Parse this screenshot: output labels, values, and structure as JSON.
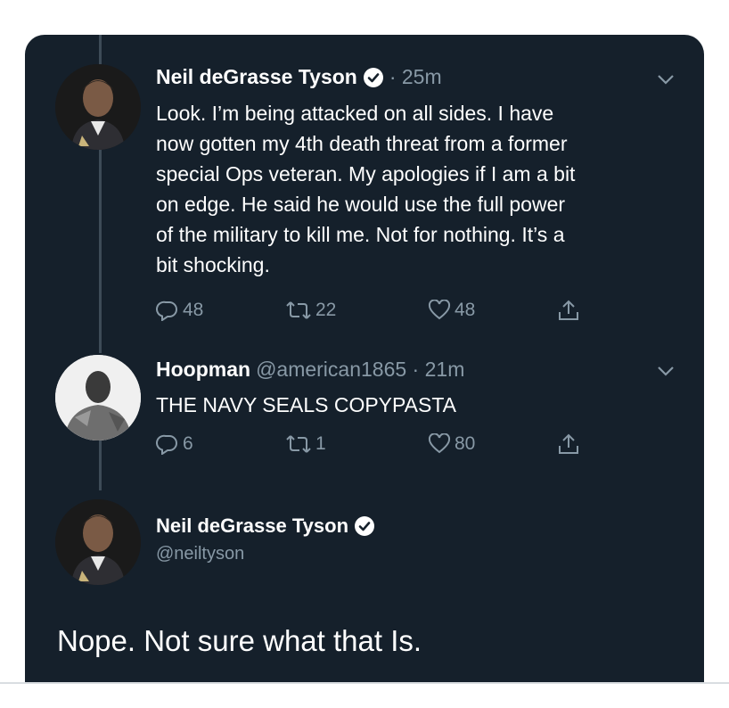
{
  "colors": {
    "background": "#15202b",
    "text": "#ffffff",
    "secondary": "#8899a6",
    "verified": "#1da1f2",
    "thread_line": "#3d4b57"
  },
  "tweets": [
    {
      "name": "Neil deGrasse Tyson",
      "verified": true,
      "time": "· 25m",
      "text": "Look. I’m being attacked on all sides. I have\nnow gotten my 4th death threat from a former\nspecial Ops veteran. My apologies if I am a bit\non edge. He said he would use the full power\nof the military to kill me. Not for nothing. It’s a\nbit shocking.",
      "replies": "48",
      "retweets": "22",
      "likes": "48",
      "icons": [
        "reply-icon",
        "retweet-icon",
        "like-icon",
        "share-icon",
        "chevron-down-icon"
      ]
    },
    {
      "name": "Hoopman",
      "handle_time": "@american1865 · 21m",
      "text": "THE NAVY SEALS COPYPASTA",
      "replies": "6",
      "retweets": "1",
      "likes": "80",
      "icons": [
        "reply-icon",
        "retweet-icon",
        "like-icon",
        "share-icon",
        "chevron-down-icon"
      ]
    }
  ],
  "main_tweet": {
    "name": "Neil deGrasse Tyson",
    "verified": true,
    "handle": "@neiltyson",
    "text": "Nope. Not sure what that Is."
  }
}
